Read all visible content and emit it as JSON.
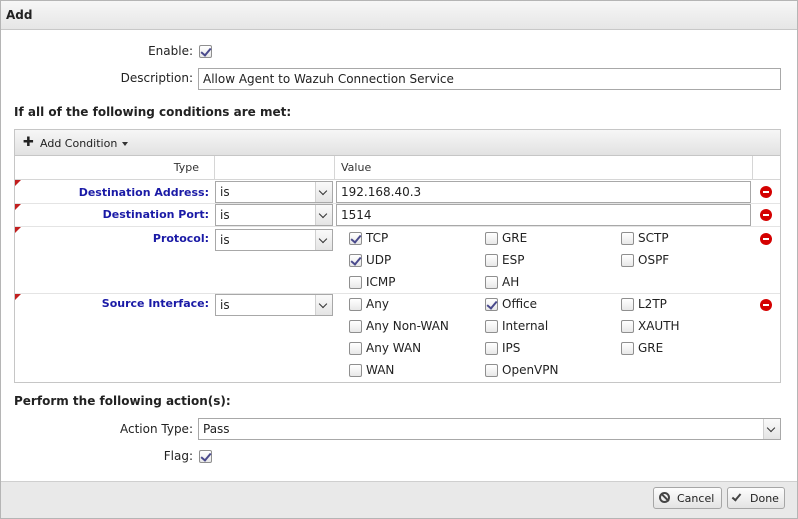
{
  "dialog": {
    "title": "Add"
  },
  "rule": {
    "enable_label": "Enable:",
    "enable_checked": true,
    "description_label": "Description:",
    "description_value": "Allow Agent to Wazuh Connection Service"
  },
  "conditions": {
    "section_title": "If all of the following conditions are met:",
    "add_condition_label": "Add Condition",
    "columns": {
      "type": "Type",
      "value": "Value"
    },
    "rows": [
      {
        "label": "Destination Address:",
        "operator": "is",
        "value": "192.168.40.3"
      },
      {
        "label": "Destination Port:",
        "operator": "is",
        "value": "1514"
      },
      {
        "label": "Protocol:",
        "operator": "is",
        "options": [
          {
            "label": "TCP",
            "checked": true
          },
          {
            "label": "GRE",
            "checked": false
          },
          {
            "label": "SCTP",
            "checked": false
          },
          {
            "label": "UDP",
            "checked": true
          },
          {
            "label": "ESP",
            "checked": false
          },
          {
            "label": "OSPF",
            "checked": false
          },
          {
            "label": "ICMP",
            "checked": false
          },
          {
            "label": "AH",
            "checked": false
          }
        ]
      },
      {
        "label": "Source Interface:",
        "operator": "is",
        "options": [
          {
            "label": "Any",
            "checked": false
          },
          {
            "label": "Office",
            "checked": true
          },
          {
            "label": "L2TP",
            "checked": false
          },
          {
            "label": "Any Non-WAN",
            "checked": false
          },
          {
            "label": "Internal",
            "checked": false
          },
          {
            "label": "XAUTH",
            "checked": false
          },
          {
            "label": "Any WAN",
            "checked": false
          },
          {
            "label": "IPS",
            "checked": false
          },
          {
            "label": "GRE",
            "checked": false
          },
          {
            "label": "WAN",
            "checked": false
          },
          {
            "label": "OpenVPN",
            "checked": false
          }
        ]
      }
    ]
  },
  "actions": {
    "section_title": "Perform the following action(s):",
    "action_type_label": "Action Type:",
    "action_type_value": "Pass",
    "flag_label": "Flag:",
    "flag_checked": true
  },
  "footer": {
    "cancel_label": "Cancel",
    "done_label": "Done"
  },
  "icons": {
    "plus": "plus-icon",
    "caret": "caret-down-icon",
    "remove": "remove-icon",
    "cancel": "cancel-icon",
    "done": "checkmark-icon"
  },
  "colors": {
    "condition_label": "#1a1aa6",
    "remove_icon": "#d40000",
    "required_flag": "#c21e1e"
  }
}
